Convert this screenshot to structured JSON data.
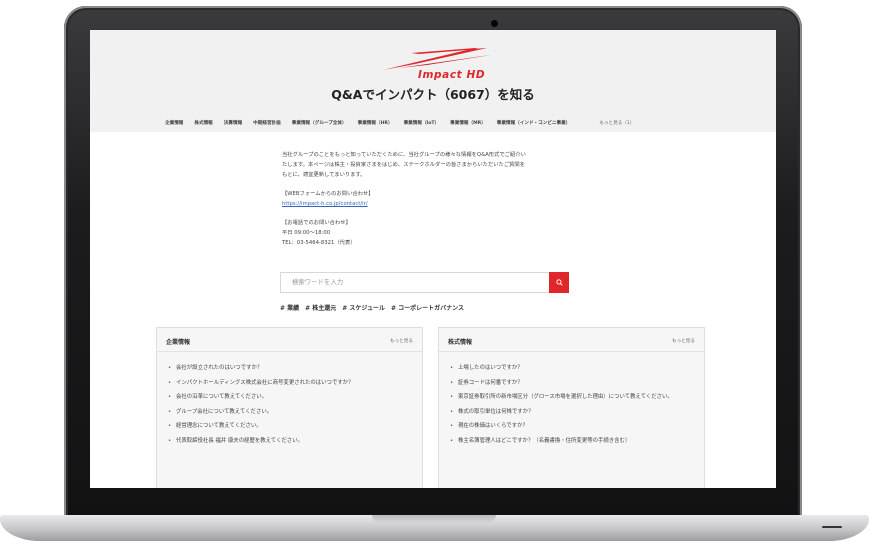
{
  "header": {
    "brand": "Impact HD",
    "title": "Q&Aでインパクト（6067）を知る"
  },
  "nav": {
    "items": [
      "企業情報",
      "株式情報",
      "決算情報",
      "中期経営計画",
      "事業情報（グループ全体）",
      "事業情報（HR）",
      "事業情報（IoT）",
      "事業情報（MR）",
      "事業情報（インド・コンビニ事業）"
    ],
    "more": "もっと見る（1）"
  },
  "intro": {
    "line1": "当社グループのことをもっと知っていただくために、当社グループの様々な情報をQ&A形式でご紹介い",
    "line2": "たします。本ページは株主・投資家さまをはじめ、ステークホルダーの皆さまからいただいたご質問を",
    "line3": "もとに、適宜更新してまいります。",
    "web_heading": "【WEBフォームからのお問い合わせ】",
    "web_link": "https://impact-h.co.jp/contact/ir/",
    "phone_heading": "【お電話でのお問い合わせ】",
    "hours": "平日 09:00～18:00",
    "tel": "TEL：03-5464-8321（代表）"
  },
  "search": {
    "placeholder": "検索ワードを入力"
  },
  "tags": [
    "# 業績",
    "# 株主還元",
    "# スケジュール",
    "# コーポレートガバナンス"
  ],
  "cards": [
    {
      "title": "企業情報",
      "more": "もっと見る",
      "items": [
        "会社が設立されたのはいつですか？",
        "インパクトホールディングス株式会社に商号変更されたのはいつですか？",
        "会社の沿革について教えてください。",
        "グループ会社について教えてください。",
        "経営理念について教えてください。",
        "代表取締役社長 福井 康夫の経歴を教えてください。"
      ]
    },
    {
      "title": "株式情報",
      "more": "もっと見る",
      "items": [
        "上場したのはいつですか？",
        "証券コードは何番ですか？",
        "東京証券取引所の新市場区分（グロース市場を選択した理由）について教えてください。",
        "株式の取引単位は何株ですか？",
        "現在の株価はいくらですか？",
        "株主名簿管理人はどこですか？（名義書換・住所変更等の手続き含む）"
      ]
    }
  ],
  "colors": {
    "brand_red": "#e0262a",
    "header_bg": "#f1f1f2",
    "card_bg": "#f6f6f7"
  },
  "icons": [
    "search-icon",
    "impact-logo-icon"
  ]
}
